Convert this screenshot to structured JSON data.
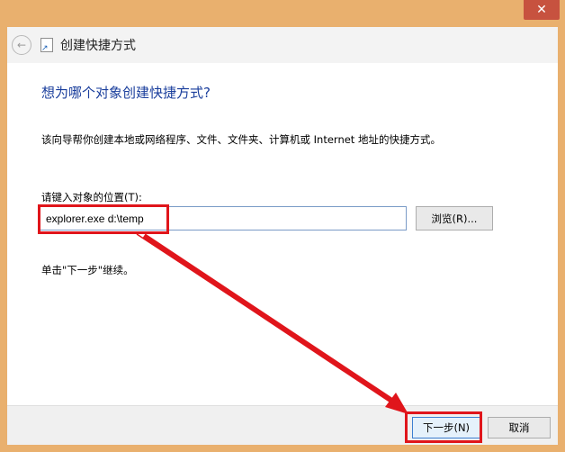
{
  "window": {
    "title": "创建快捷方式",
    "close_glyph": "✕",
    "back_glyph": "←"
  },
  "content": {
    "heading": "想为哪个对象创建快捷方式?",
    "description": "该向导帮你创建本地或网络程序、文件、文件夹、计算机或 Internet 地址的快捷方式。",
    "location_label": "请键入对象的位置(T):",
    "location_value": "explorer.exe d:\\temp",
    "browse_label": "浏览(R)...",
    "hint": "单击\"下一步\"继续。"
  },
  "footer": {
    "next_label": "下一步(N)",
    "cancel_label": "取消"
  },
  "annotation": {
    "color": "#e0151b"
  }
}
